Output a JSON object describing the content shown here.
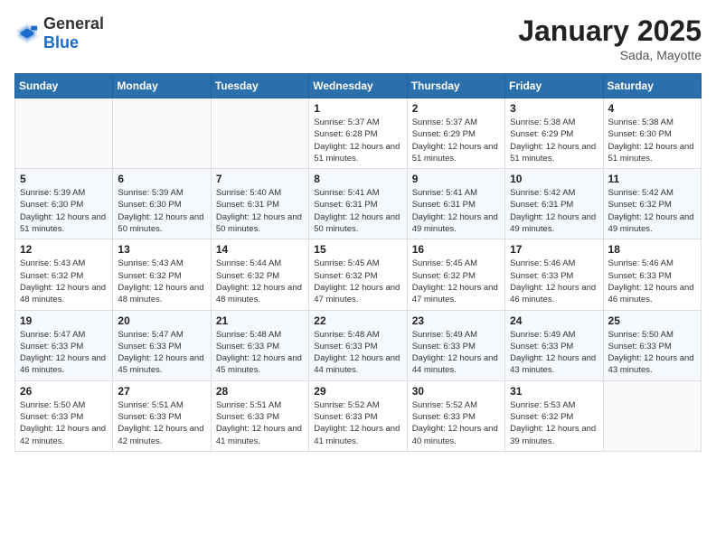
{
  "header": {
    "logo_general": "General",
    "logo_blue": "Blue",
    "month_year": "January 2025",
    "location": "Sada, Mayotte"
  },
  "weekdays": [
    "Sunday",
    "Monday",
    "Tuesday",
    "Wednesday",
    "Thursday",
    "Friday",
    "Saturday"
  ],
  "weeks": [
    [
      {
        "day": "",
        "sunrise": "",
        "sunset": "",
        "daylight": ""
      },
      {
        "day": "",
        "sunrise": "",
        "sunset": "",
        "daylight": ""
      },
      {
        "day": "",
        "sunrise": "",
        "sunset": "",
        "daylight": ""
      },
      {
        "day": "1",
        "sunrise": "Sunrise: 5:37 AM",
        "sunset": "Sunset: 6:28 PM",
        "daylight": "Daylight: 12 hours and 51 minutes."
      },
      {
        "day": "2",
        "sunrise": "Sunrise: 5:37 AM",
        "sunset": "Sunset: 6:29 PM",
        "daylight": "Daylight: 12 hours and 51 minutes."
      },
      {
        "day": "3",
        "sunrise": "Sunrise: 5:38 AM",
        "sunset": "Sunset: 6:29 PM",
        "daylight": "Daylight: 12 hours and 51 minutes."
      },
      {
        "day": "4",
        "sunrise": "Sunrise: 5:38 AM",
        "sunset": "Sunset: 6:30 PM",
        "daylight": "Daylight: 12 hours and 51 minutes."
      }
    ],
    [
      {
        "day": "5",
        "sunrise": "Sunrise: 5:39 AM",
        "sunset": "Sunset: 6:30 PM",
        "daylight": "Daylight: 12 hours and 51 minutes."
      },
      {
        "day": "6",
        "sunrise": "Sunrise: 5:39 AM",
        "sunset": "Sunset: 6:30 PM",
        "daylight": "Daylight: 12 hours and 50 minutes."
      },
      {
        "day": "7",
        "sunrise": "Sunrise: 5:40 AM",
        "sunset": "Sunset: 6:31 PM",
        "daylight": "Daylight: 12 hours and 50 minutes."
      },
      {
        "day": "8",
        "sunrise": "Sunrise: 5:41 AM",
        "sunset": "Sunset: 6:31 PM",
        "daylight": "Daylight: 12 hours and 50 minutes."
      },
      {
        "day": "9",
        "sunrise": "Sunrise: 5:41 AM",
        "sunset": "Sunset: 6:31 PM",
        "daylight": "Daylight: 12 hours and 49 minutes."
      },
      {
        "day": "10",
        "sunrise": "Sunrise: 5:42 AM",
        "sunset": "Sunset: 6:31 PM",
        "daylight": "Daylight: 12 hours and 49 minutes."
      },
      {
        "day": "11",
        "sunrise": "Sunrise: 5:42 AM",
        "sunset": "Sunset: 6:32 PM",
        "daylight": "Daylight: 12 hours and 49 minutes."
      }
    ],
    [
      {
        "day": "12",
        "sunrise": "Sunrise: 5:43 AM",
        "sunset": "Sunset: 6:32 PM",
        "daylight": "Daylight: 12 hours and 48 minutes."
      },
      {
        "day": "13",
        "sunrise": "Sunrise: 5:43 AM",
        "sunset": "Sunset: 6:32 PM",
        "daylight": "Daylight: 12 hours and 48 minutes."
      },
      {
        "day": "14",
        "sunrise": "Sunrise: 5:44 AM",
        "sunset": "Sunset: 6:32 PM",
        "daylight": "Daylight: 12 hours and 48 minutes."
      },
      {
        "day": "15",
        "sunrise": "Sunrise: 5:45 AM",
        "sunset": "Sunset: 6:32 PM",
        "daylight": "Daylight: 12 hours and 47 minutes."
      },
      {
        "day": "16",
        "sunrise": "Sunrise: 5:45 AM",
        "sunset": "Sunset: 6:32 PM",
        "daylight": "Daylight: 12 hours and 47 minutes."
      },
      {
        "day": "17",
        "sunrise": "Sunrise: 5:46 AM",
        "sunset": "Sunset: 6:33 PM",
        "daylight": "Daylight: 12 hours and 46 minutes."
      },
      {
        "day": "18",
        "sunrise": "Sunrise: 5:46 AM",
        "sunset": "Sunset: 6:33 PM",
        "daylight": "Daylight: 12 hours and 46 minutes."
      }
    ],
    [
      {
        "day": "19",
        "sunrise": "Sunrise: 5:47 AM",
        "sunset": "Sunset: 6:33 PM",
        "daylight": "Daylight: 12 hours and 46 minutes."
      },
      {
        "day": "20",
        "sunrise": "Sunrise: 5:47 AM",
        "sunset": "Sunset: 6:33 PM",
        "daylight": "Daylight: 12 hours and 45 minutes."
      },
      {
        "day": "21",
        "sunrise": "Sunrise: 5:48 AM",
        "sunset": "Sunset: 6:33 PM",
        "daylight": "Daylight: 12 hours and 45 minutes."
      },
      {
        "day": "22",
        "sunrise": "Sunrise: 5:48 AM",
        "sunset": "Sunset: 6:33 PM",
        "daylight": "Daylight: 12 hours and 44 minutes."
      },
      {
        "day": "23",
        "sunrise": "Sunrise: 5:49 AM",
        "sunset": "Sunset: 6:33 PM",
        "daylight": "Daylight: 12 hours and 44 minutes."
      },
      {
        "day": "24",
        "sunrise": "Sunrise: 5:49 AM",
        "sunset": "Sunset: 6:33 PM",
        "daylight": "Daylight: 12 hours and 43 minutes."
      },
      {
        "day": "25",
        "sunrise": "Sunrise: 5:50 AM",
        "sunset": "Sunset: 6:33 PM",
        "daylight": "Daylight: 12 hours and 43 minutes."
      }
    ],
    [
      {
        "day": "26",
        "sunrise": "Sunrise: 5:50 AM",
        "sunset": "Sunset: 6:33 PM",
        "daylight": "Daylight: 12 hours and 42 minutes."
      },
      {
        "day": "27",
        "sunrise": "Sunrise: 5:51 AM",
        "sunset": "Sunset: 6:33 PM",
        "daylight": "Daylight: 12 hours and 42 minutes."
      },
      {
        "day": "28",
        "sunrise": "Sunrise: 5:51 AM",
        "sunset": "Sunset: 6:33 PM",
        "daylight": "Daylight: 12 hours and 41 minutes."
      },
      {
        "day": "29",
        "sunrise": "Sunrise: 5:52 AM",
        "sunset": "Sunset: 6:33 PM",
        "daylight": "Daylight: 12 hours and 41 minutes."
      },
      {
        "day": "30",
        "sunrise": "Sunrise: 5:52 AM",
        "sunset": "Sunset: 6:33 PM",
        "daylight": "Daylight: 12 hours and 40 minutes."
      },
      {
        "day": "31",
        "sunrise": "Sunrise: 5:53 AM",
        "sunset": "Sunset: 6:32 PM",
        "daylight": "Daylight: 12 hours and 39 minutes."
      },
      {
        "day": "",
        "sunrise": "",
        "sunset": "",
        "daylight": ""
      }
    ]
  ]
}
